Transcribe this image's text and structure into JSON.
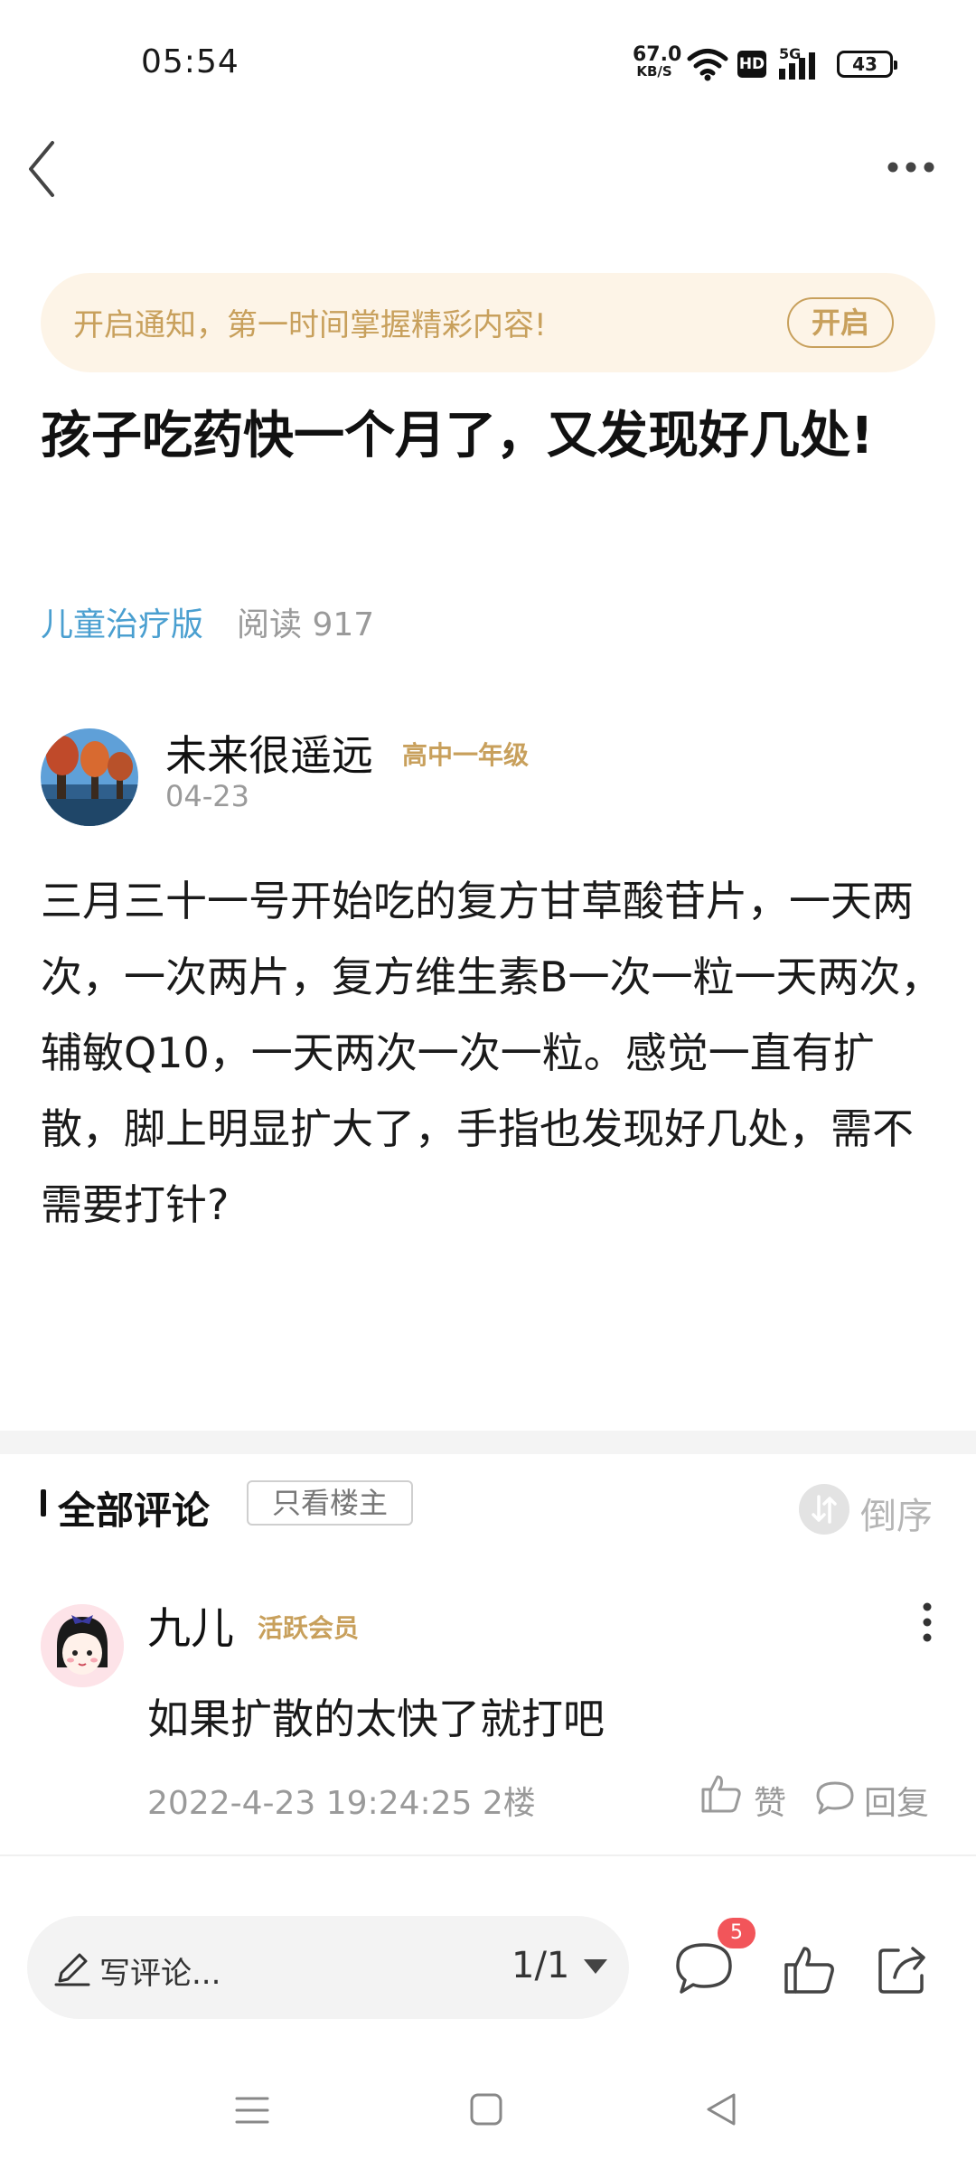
{
  "status_bar": {
    "time": "05:54",
    "net_speed_value": "67.0",
    "net_speed_unit": "KB/S",
    "hd_label": "HD",
    "network_label": "5G",
    "battery": "43"
  },
  "notification": {
    "text": "开启通知，第一时间掌握精彩内容!",
    "button": "开启"
  },
  "post": {
    "title": "孩子吃药快一个月了，又发现好几处!",
    "board": "儿童治疗版",
    "reads": "阅读 917",
    "author": "未来很遥远",
    "author_badge": "高中一年级",
    "date": "04-23",
    "body": "三月三十一号开始吃的复方甘草酸苷片，一天两次，一次两片，复方维生素B一次一粒一天两次，辅敏Q10，一天两次一次一粒。感觉一直有扩散，脚上明显扩大了，手指也发现好几处，需不需要打针?"
  },
  "comments": {
    "title": "全部评论",
    "op_only": "只看楼主",
    "sort_label": "倒序",
    "items": [
      {
        "name": "九儿",
        "badge": "活跃会员",
        "text": "如果扩散的太快了就打吧",
        "meta": "2022-4-23 19:24:25  2楼",
        "like_label": "赞",
        "reply_label": "回复"
      }
    ]
  },
  "bottom_bar": {
    "write_placeholder": "写评论...",
    "page_indicator": "1/1",
    "comment_count": "5"
  },
  "colors": {
    "accent_gold": "#c8a05c",
    "link_blue": "#4a9fd0",
    "badge_red": "#f2555a",
    "banner_bg": "#fdf4e7"
  },
  "icons": [
    "back-icon",
    "more-icon",
    "wifi-icon",
    "signal-icon",
    "pen-icon",
    "comment-icon",
    "thumb-up-icon",
    "share-icon",
    "like-icon",
    "reply-icon",
    "sort-icon"
  ]
}
